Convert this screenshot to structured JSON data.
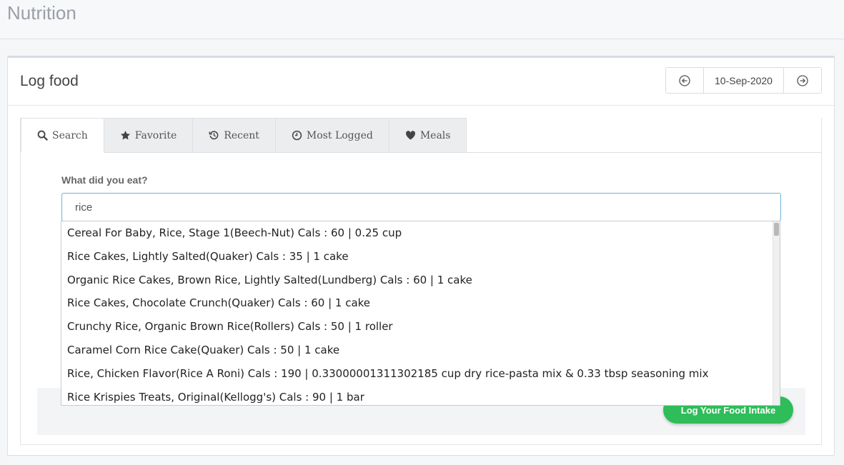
{
  "page": {
    "title": "Nutrition"
  },
  "card": {
    "title": "Log food"
  },
  "date_nav": {
    "prev_icon": "arrow-left-circle-icon",
    "date": "10-Sep-2020",
    "next_icon": "arrow-right-circle-icon"
  },
  "tabs": [
    {
      "label": "Search",
      "icon": "search-icon",
      "active": true
    },
    {
      "label": "Favorite",
      "icon": "star-icon",
      "active": false
    },
    {
      "label": "Recent",
      "icon": "history-icon",
      "active": false
    },
    {
      "label": "Most Logged",
      "icon": "clock-icon",
      "active": false
    },
    {
      "label": "Meals",
      "icon": "heart-icon",
      "active": false
    }
  ],
  "search": {
    "label": "What did you eat?",
    "value": "rice"
  },
  "suggestions": [
    "Cereal For Baby, Rice, Stage 1(Beech-Nut) Cals : 60 | 0.25 cup",
    "Rice Cakes, Lightly Salted(Quaker) Cals : 35 | 1 cake",
    "Organic Rice Cakes, Brown Rice, Lightly Salted(Lundberg) Cals : 60 | 1 cake",
    "Rice Cakes, Chocolate Crunch(Quaker) Cals : 60 | 1 cake",
    "Crunchy Rice, Organic Brown Rice(Rollers) Cals : 50 | 1 roller",
    "Caramel Corn Rice Cake(Quaker) Cals : 50 | 1 cake",
    "Rice, Chicken Flavor(Rice A Roni) Cals : 190 | 0.33000001311302185 cup dry rice-pasta mix & 0.33 tbsp seasoning mix",
    "Rice Krispies Treats, Original(Kellogg's) Cals : 90 | 1 bar"
  ],
  "actions": {
    "log_label": "Log Your Food Intake"
  },
  "colors": {
    "accent_green": "#2ebd59",
    "input_border": "#6fb3d6"
  }
}
